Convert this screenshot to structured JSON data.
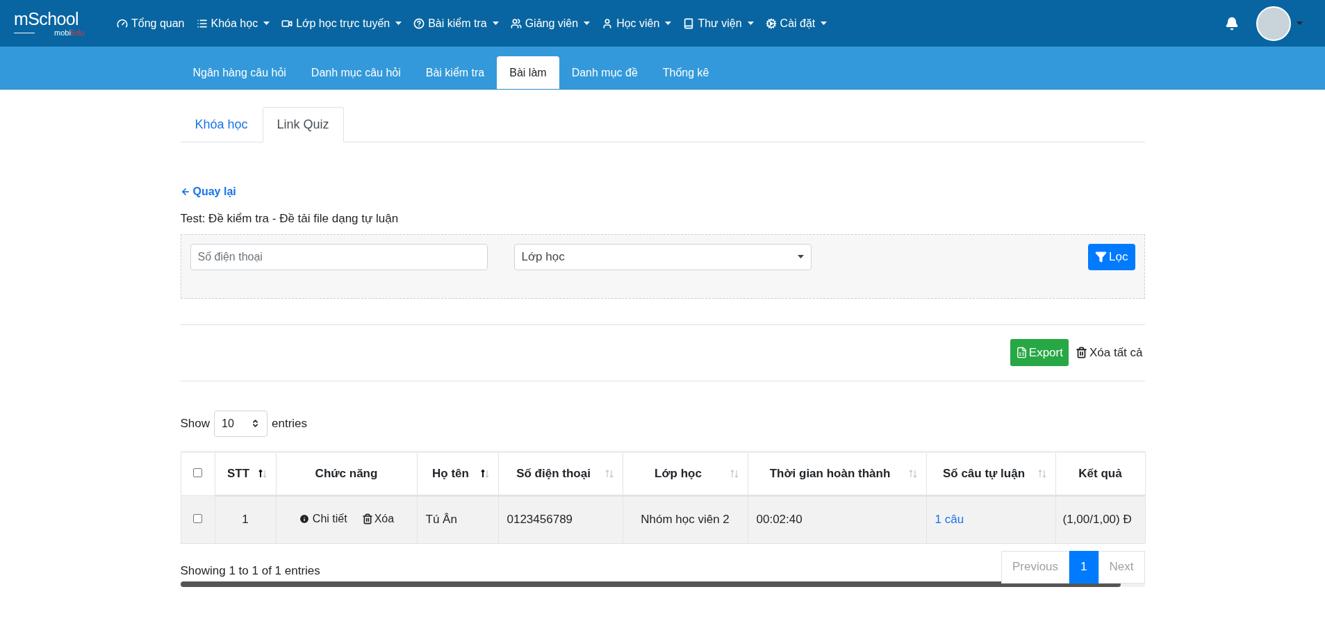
{
  "logo": {
    "title": "mSchool",
    "subtitle": [
      {
        "text": "mobi",
        "color": "#ffffff"
      },
      {
        "text": "Edu",
        "color": "#e53935"
      }
    ]
  },
  "top_nav": [
    {
      "label": "Tổng quan",
      "has_menu": false
    },
    {
      "label": "Khóa học",
      "has_menu": true
    },
    {
      "label": "Lớp học trực tuyến",
      "has_menu": true
    },
    {
      "label": "Bài kiểm tra",
      "has_menu": true
    },
    {
      "label": "Giảng viên",
      "has_menu": true
    },
    {
      "label": "Học viên",
      "has_menu": true
    },
    {
      "label": "Thư viện",
      "has_menu": true
    },
    {
      "label": "Cài đặt",
      "has_menu": true
    }
  ],
  "sub_nav": [
    {
      "label": "Ngân hàng câu hỏi",
      "selected": false
    },
    {
      "label": "Danh mục câu hỏi",
      "selected": false
    },
    {
      "label": "Bài kiểm tra",
      "selected": false
    },
    {
      "label": "Bài làm",
      "selected": true
    },
    {
      "label": "Danh mục đề",
      "selected": false
    },
    {
      "label": "Thống kê",
      "selected": false
    }
  ],
  "tabs": [
    {
      "label": "Khóa học",
      "selected": false
    },
    {
      "label": "Link Quiz",
      "selected": true
    }
  ],
  "back_link": "Quay lại",
  "test_title": "Test: Đề kiểm tra - Đề tải file dạng tự luận",
  "filter": {
    "phone": {
      "placeholder": "Số điện thoại"
    },
    "class_select": {
      "placeholder": "Lớp học"
    },
    "button": "Lọc"
  },
  "actions": {
    "export": "Export",
    "delete_all": "Xóa tất cả"
  },
  "length": {
    "show": "Show",
    "value": "10",
    "entries": "entries"
  },
  "table": {
    "header_checked": false,
    "columns": [
      {
        "label": "STT",
        "sortable": true,
        "sorted_ascending": true
      },
      {
        "label": "Chức năng",
        "sortable": false,
        "sorted_ascending": false
      },
      {
        "label": "Họ tên",
        "sortable": true,
        "sorted_ascending": true
      },
      {
        "label": "Số điện thoại",
        "sortable": true,
        "sorted_ascending": false
      },
      {
        "label": "Lớp học",
        "sortable": true,
        "sorted_ascending": false
      },
      {
        "label": "Thời gian hoàn thành",
        "sortable": true,
        "sorted_ascending": false
      },
      {
        "label": "Số câu tự luận",
        "sortable": true,
        "sorted_ascending": false
      },
      {
        "label": "Kết quả",
        "sortable": false,
        "sorted_ascending": false
      }
    ],
    "rows": [
      {
        "checked": false,
        "stt": "1",
        "detail": "Chi tiết",
        "delete": "Xóa",
        "name": "Tú Ân",
        "phone": "0123456789",
        "class": "Nhóm học viên 2",
        "time": "00:02:40",
        "essay": "1 câu",
        "result": "(1,00/1,00) Đ"
      }
    ]
  },
  "info": "Showing 1 to 1 of 1 entries",
  "pagination": [
    {
      "label": "Previous",
      "selected": false,
      "disabled": true
    },
    {
      "label": "1",
      "selected": true,
      "disabled": false
    },
    {
      "label": "Next",
      "selected": false,
      "disabled": true
    }
  ]
}
